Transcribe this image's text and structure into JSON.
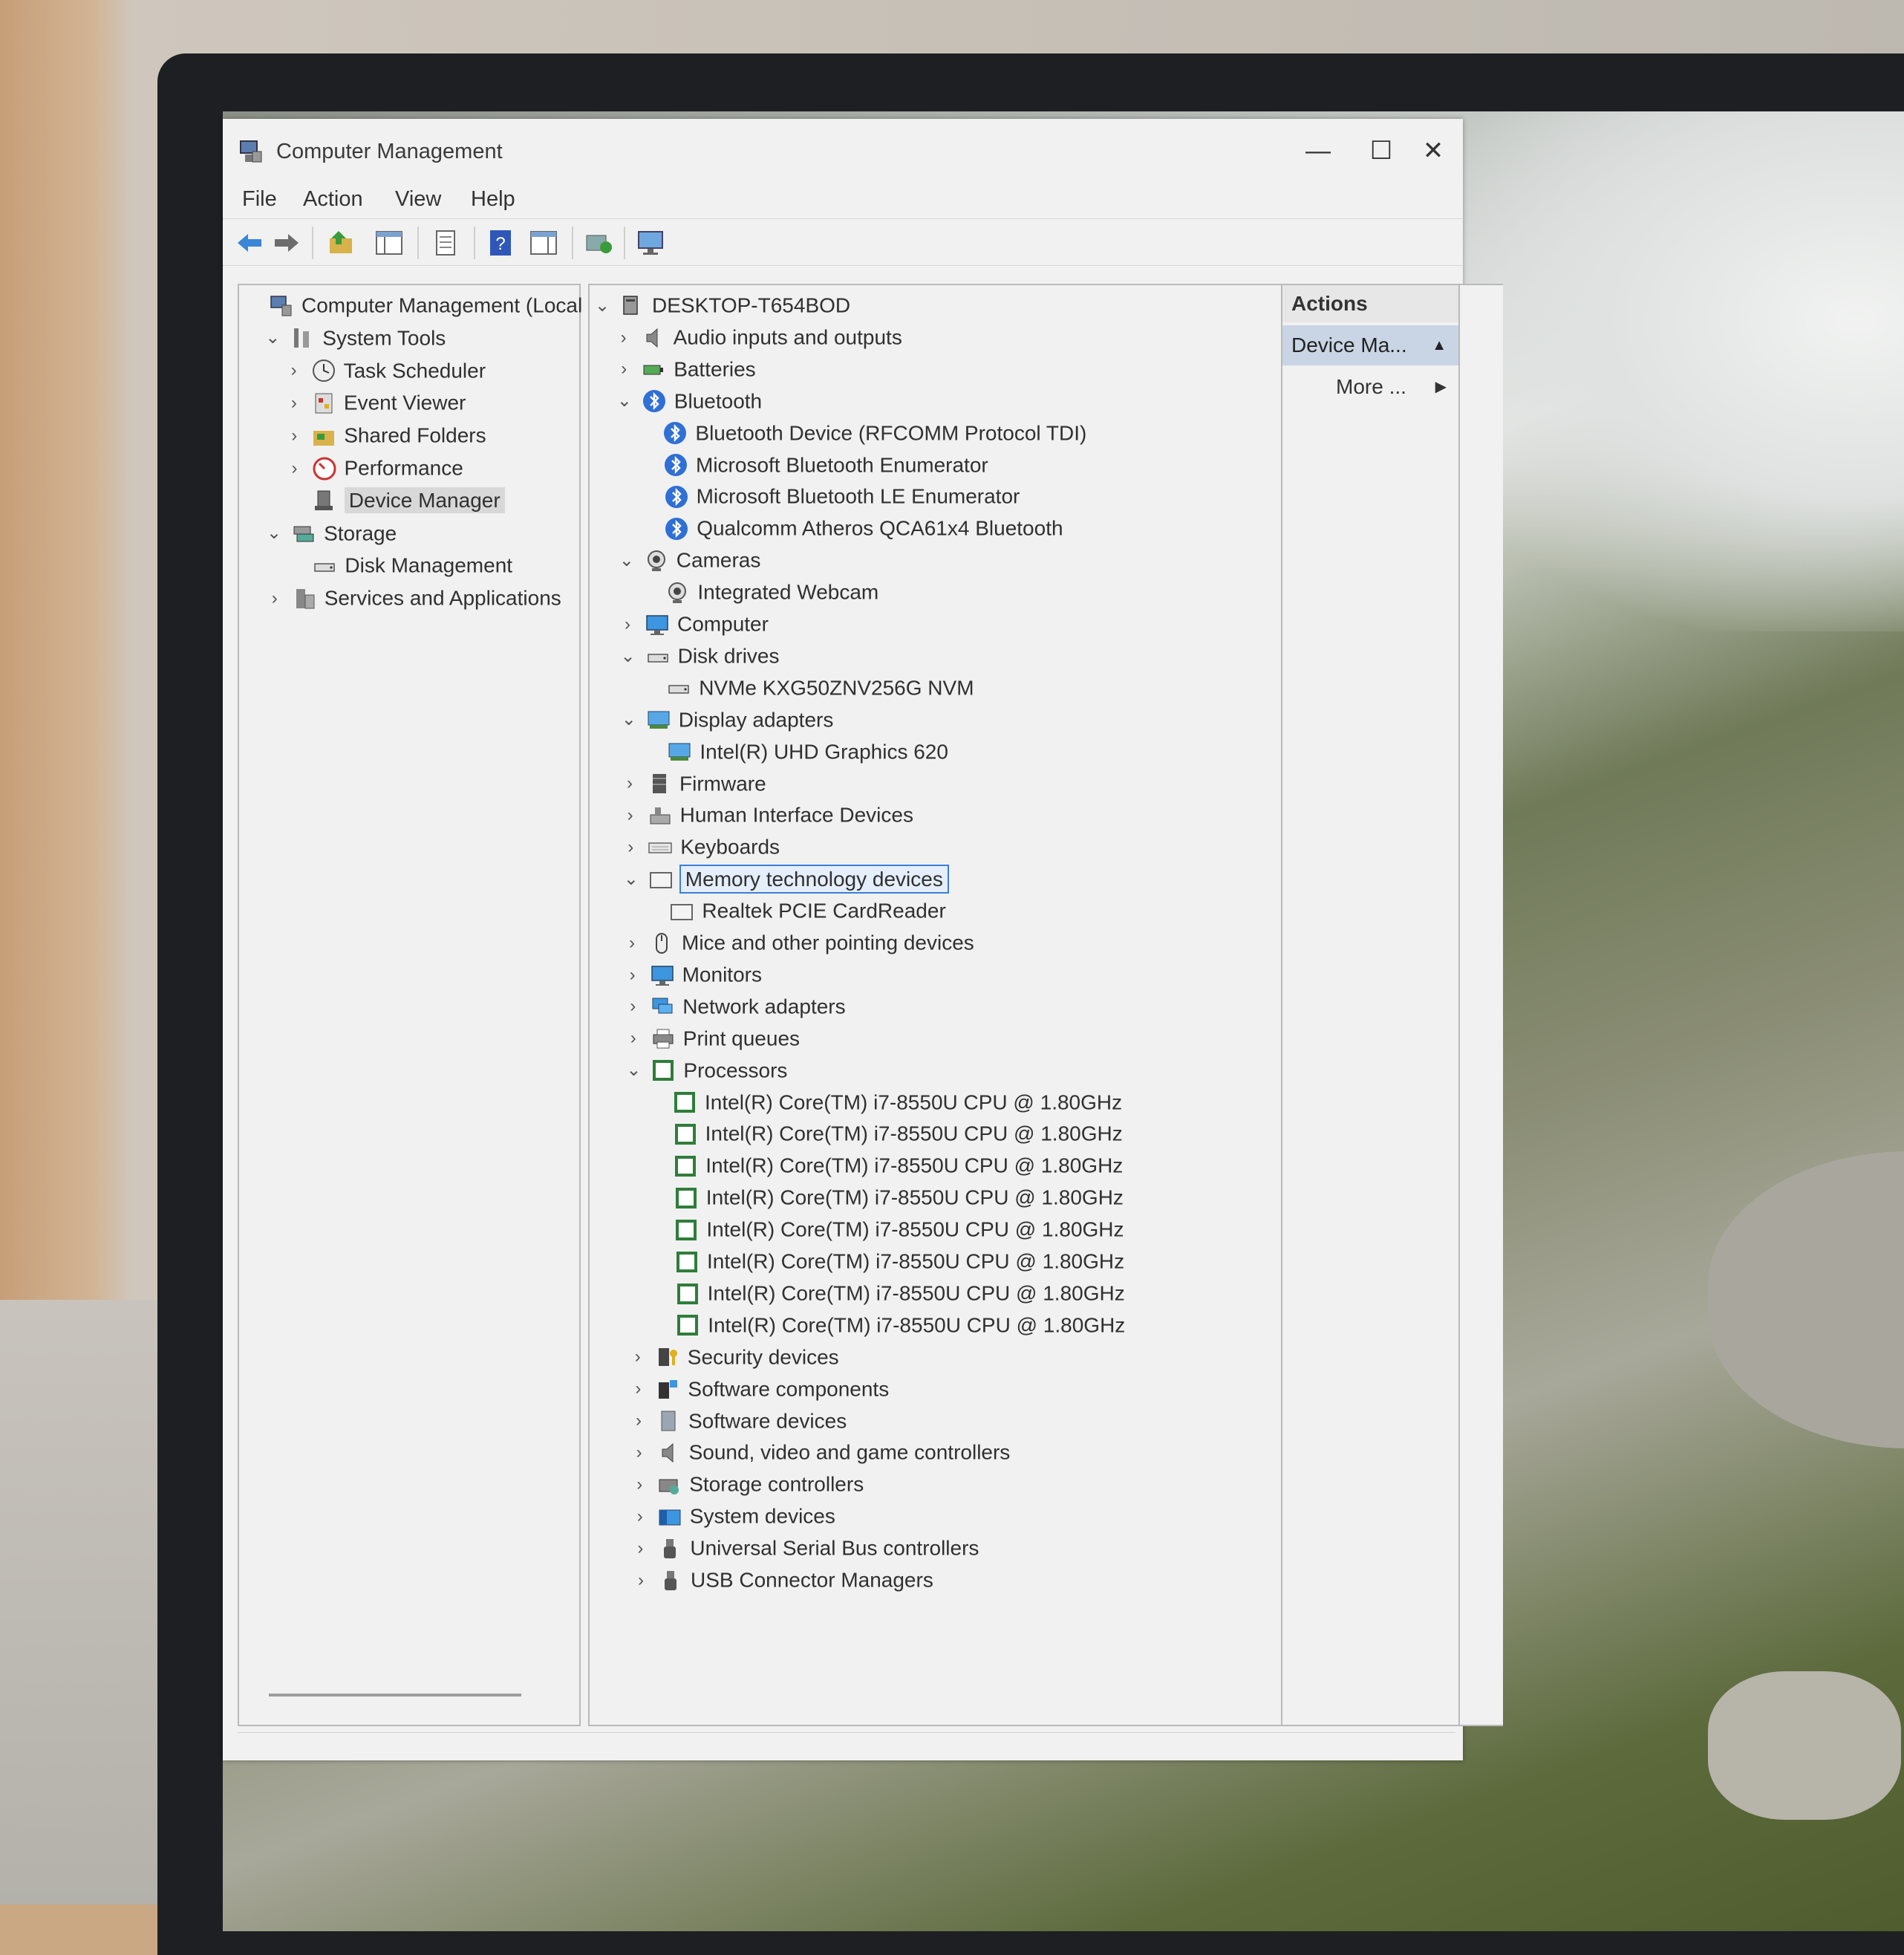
{
  "window": {
    "title": "Computer Management",
    "minimize": "—",
    "maximize": "☐",
    "close": "✕"
  },
  "menu": [
    "File",
    "Action",
    "View",
    "Help"
  ],
  "toolbar": [
    "back-arrow-icon",
    "forward-arrow-icon",
    "up-folder-icon",
    "show-hide-tree-icon",
    "properties-icon",
    "help-icon",
    "console-view-icon",
    "scan-hardware-icon",
    "monitor-icon"
  ],
  "left_tree": [
    {
      "label": "Computer Management (Local",
      "level": 0,
      "chevron": "",
      "icon": "computer-management-icon"
    },
    {
      "label": "System Tools",
      "level": 1,
      "chevron": "⌄",
      "icon": "tools-icon"
    },
    {
      "label": "Task Scheduler",
      "level": 2,
      "chevron": "›",
      "icon": "clock-icon"
    },
    {
      "label": "Event Viewer",
      "level": 2,
      "chevron": "›",
      "icon": "event-viewer-icon"
    },
    {
      "label": "Shared Folders",
      "level": 2,
      "chevron": "›",
      "icon": "shared-folders-icon"
    },
    {
      "label": "Performance",
      "level": 2,
      "chevron": "›",
      "icon": "performance-icon"
    },
    {
      "label": "Device Manager",
      "level": 2,
      "chevron": "",
      "icon": "device-manager-icon",
      "selected": true
    },
    {
      "label": "Storage",
      "level": 1,
      "chevron": "⌄",
      "icon": "storage-icon"
    },
    {
      "label": "Disk Management",
      "level": 2,
      "chevron": "",
      "icon": "disk-icon"
    },
    {
      "label": "Services and Applications",
      "level": 1,
      "chevron": "›",
      "icon": "services-icon"
    }
  ],
  "device_tree": [
    {
      "label": "DESKTOP-T654BOD",
      "level": 0,
      "chevron": "⌄",
      "icon": "computer-icon"
    },
    {
      "label": "Audio inputs and outputs",
      "level": 1,
      "chevron": "›",
      "icon": "speaker-icon"
    },
    {
      "label": "Batteries",
      "level": 1,
      "chevron": "›",
      "icon": "battery-icon"
    },
    {
      "label": "Bluetooth",
      "level": 1,
      "chevron": "⌄",
      "icon": "bluetooth-icon"
    },
    {
      "label": "Bluetooth Device (RFCOMM Protocol TDI)",
      "level": 2,
      "chevron": "",
      "icon": "bluetooth-icon"
    },
    {
      "label": "Microsoft Bluetooth Enumerator",
      "level": 2,
      "chevron": "",
      "icon": "bluetooth-icon"
    },
    {
      "label": "Microsoft Bluetooth LE Enumerator",
      "level": 2,
      "chevron": "",
      "icon": "bluetooth-icon"
    },
    {
      "label": "Qualcomm Atheros QCA61x4 Bluetooth",
      "level": 2,
      "chevron": "",
      "icon": "bluetooth-icon"
    },
    {
      "label": "Cameras",
      "level": 1,
      "chevron": "⌄",
      "icon": "camera-icon"
    },
    {
      "label": "Integrated Webcam",
      "level": 2,
      "chevron": "",
      "icon": "camera-icon"
    },
    {
      "label": "Computer",
      "level": 1,
      "chevron": "›",
      "icon": "monitor-icon"
    },
    {
      "label": "Disk drives",
      "level": 1,
      "chevron": "⌄",
      "icon": "disk-icon"
    },
    {
      "label": "NVMe KXG50ZNV256G NVM",
      "level": 2,
      "chevron": "",
      "icon": "disk-icon"
    },
    {
      "label": "Display adapters",
      "level": 1,
      "chevron": "⌄",
      "icon": "display-adapter-icon"
    },
    {
      "label": "Intel(R) UHD Graphics 620",
      "level": 2,
      "chevron": "",
      "icon": "display-adapter-icon"
    },
    {
      "label": "Firmware",
      "level": 1,
      "chevron": "›",
      "icon": "firmware-icon"
    },
    {
      "label": "Human Interface Devices",
      "level": 1,
      "chevron": "›",
      "icon": "hid-icon"
    },
    {
      "label": "Keyboards",
      "level": 1,
      "chevron": "›",
      "icon": "keyboard-icon"
    },
    {
      "label": "Memory technology devices",
      "level": 1,
      "chevron": "⌄",
      "icon": "memory-icon",
      "focused": true
    },
    {
      "label": "Realtek PCIE CardReader",
      "level": 2,
      "chevron": "",
      "icon": "memory-icon"
    },
    {
      "label": "Mice and other pointing devices",
      "level": 1,
      "chevron": "›",
      "icon": "mouse-icon"
    },
    {
      "label": "Monitors",
      "level": 1,
      "chevron": "›",
      "icon": "monitor-icon"
    },
    {
      "label": "Network adapters",
      "level": 1,
      "chevron": "›",
      "icon": "network-icon"
    },
    {
      "label": "Print queues",
      "level": 1,
      "chevron": "›",
      "icon": "printer-icon"
    },
    {
      "label": "Processors",
      "level": 1,
      "chevron": "⌄",
      "icon": "processor-icon"
    },
    {
      "label": "Intel(R) Core(TM) i7-8550U CPU @ 1.80GHz",
      "level": 2,
      "chevron": "",
      "icon": "processor-icon"
    },
    {
      "label": "Intel(R) Core(TM) i7-8550U CPU @ 1.80GHz",
      "level": 2,
      "chevron": "",
      "icon": "processor-icon"
    },
    {
      "label": "Intel(R) Core(TM) i7-8550U CPU @ 1.80GHz",
      "level": 2,
      "chevron": "",
      "icon": "processor-icon"
    },
    {
      "label": "Intel(R) Core(TM) i7-8550U CPU @ 1.80GHz",
      "level": 2,
      "chevron": "",
      "icon": "processor-icon"
    },
    {
      "label": "Intel(R) Core(TM) i7-8550U CPU @ 1.80GHz",
      "level": 2,
      "chevron": "",
      "icon": "processor-icon"
    },
    {
      "label": "Intel(R) Core(TM) i7-8550U CPU @ 1.80GHz",
      "level": 2,
      "chevron": "",
      "icon": "processor-icon"
    },
    {
      "label": "Intel(R) Core(TM) i7-8550U CPU @ 1.80GHz",
      "level": 2,
      "chevron": "",
      "icon": "processor-icon"
    },
    {
      "label": "Intel(R) Core(TM) i7-8550U CPU @ 1.80GHz",
      "level": 2,
      "chevron": "",
      "icon": "processor-icon"
    },
    {
      "label": "Security devices",
      "level": 1,
      "chevron": "›",
      "icon": "security-icon"
    },
    {
      "label": "Software components",
      "level": 1,
      "chevron": "›",
      "icon": "software-component-icon"
    },
    {
      "label": "Software devices",
      "level": 1,
      "chevron": "›",
      "icon": "software-device-icon"
    },
    {
      "label": "Sound, video and game controllers",
      "level": 1,
      "chevron": "›",
      "icon": "speaker-icon"
    },
    {
      "label": "Storage controllers",
      "level": 1,
      "chevron": "›",
      "icon": "storage-controller-icon"
    },
    {
      "label": "System devices",
      "level": 1,
      "chevron": "›",
      "icon": "system-device-icon"
    },
    {
      "label": "Universal Serial Bus controllers",
      "level": 1,
      "chevron": "›",
      "icon": "usb-icon"
    },
    {
      "label": "USB Connector Managers",
      "level": 1,
      "chevron": "›",
      "icon": "usb-icon"
    }
  ],
  "actions": {
    "header": "Actions",
    "section": "Device Ma...",
    "section_arrow": "▲",
    "more": "More ...",
    "more_arrow": "▶"
  },
  "colors": {
    "accent": "#3c7fd8",
    "bluetooth": "#2f6fd6",
    "processor": "#2f7d3a",
    "selection": "#c9d5e5"
  }
}
